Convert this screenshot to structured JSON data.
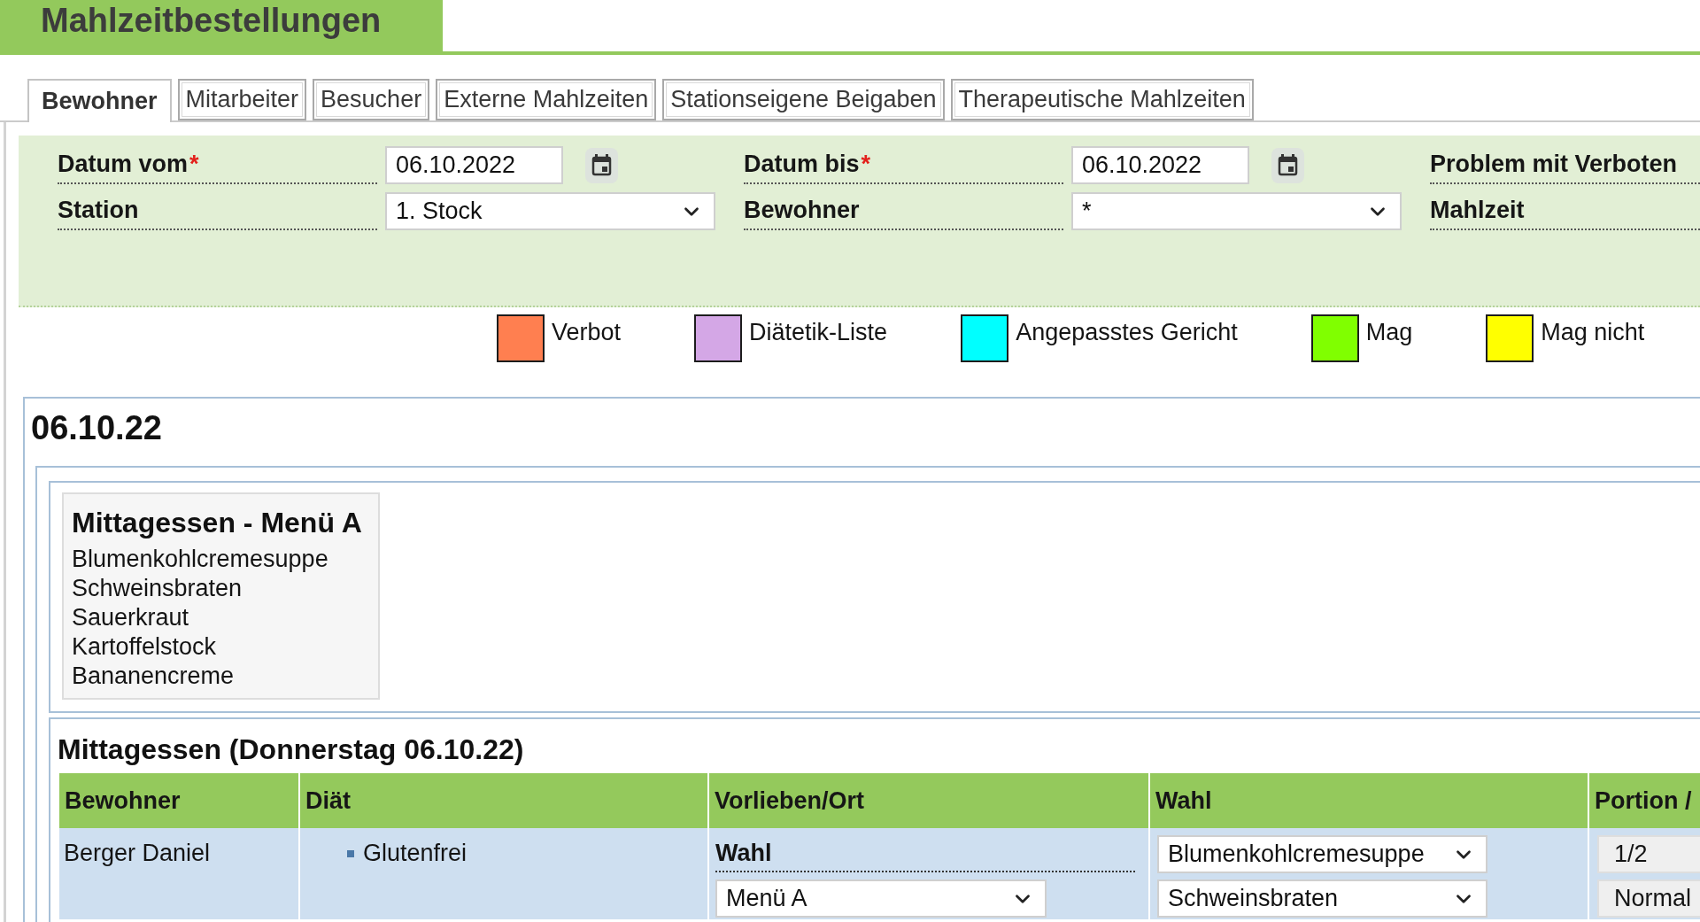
{
  "header": {
    "title": "Mahlzeitbestellungen"
  },
  "tabs": [
    {
      "label": "Bewohner",
      "selected": true
    },
    {
      "label": "Mitarbeiter",
      "selected": false
    },
    {
      "label": "Besucher",
      "selected": false
    },
    {
      "label": "Externe Mahlzeiten",
      "selected": false
    },
    {
      "label": "Stationseigene Beigaben",
      "selected": false
    },
    {
      "label": "Therapeutische Mahlzeiten",
      "selected": false
    }
  ],
  "filters": [
    {
      "label": "Datum vom",
      "required_mark": "*",
      "kind": "date",
      "value": "06.10.2022"
    },
    {
      "label": "Datum bis",
      "required_mark": "*",
      "kind": "date",
      "value": "06.10.2022"
    },
    {
      "label": "Problem mit Verboten",
      "kind": "label"
    },
    {
      "label": "Station",
      "kind": "select",
      "value": "1. Stock"
    },
    {
      "label": "Bewohner",
      "kind": "select",
      "value": "*"
    },
    {
      "label": "Mahlzeit",
      "kind": "label"
    }
  ],
  "legend": [
    {
      "label": "Verbot",
      "color": "#ff7f50"
    },
    {
      "label": "Diätetik-Liste",
      "color": "#d4a7e6"
    },
    {
      "label": "Angepasstes Gericht",
      "color": "#00ffff"
    },
    {
      "label": "Mag",
      "color": "#80ff00"
    },
    {
      "label": "Mag nicht",
      "color": "#ffff00"
    }
  ],
  "day": {
    "title": "06.10.22",
    "menu_card": {
      "title": "Mittagessen - Menü A",
      "items": [
        "Blumenkohlcremesuppe",
        "Schweinsbraten",
        "Sauerkraut",
        "Kartoffelstock",
        "Bananencreme"
      ]
    },
    "meal": {
      "title": "Mittagessen (Donnerstag 06.10.22)",
      "table": {
        "columns": [
          "Bewohner",
          "Diät",
          "Vorlieben/Ort",
          "Wahl",
          "Portion /"
        ],
        "rows": [
          {
            "resident": "Berger Daniel",
            "diets": [
              "Glutenfrei"
            ],
            "preference": {
              "label": "Wahl",
              "value": "Menü A"
            },
            "choices": [
              "Blumenkohlcremesuppe",
              "Schweinsbraten"
            ],
            "portions": [
              "1/2",
              "Normal"
            ]
          }
        ]
      }
    }
  }
}
